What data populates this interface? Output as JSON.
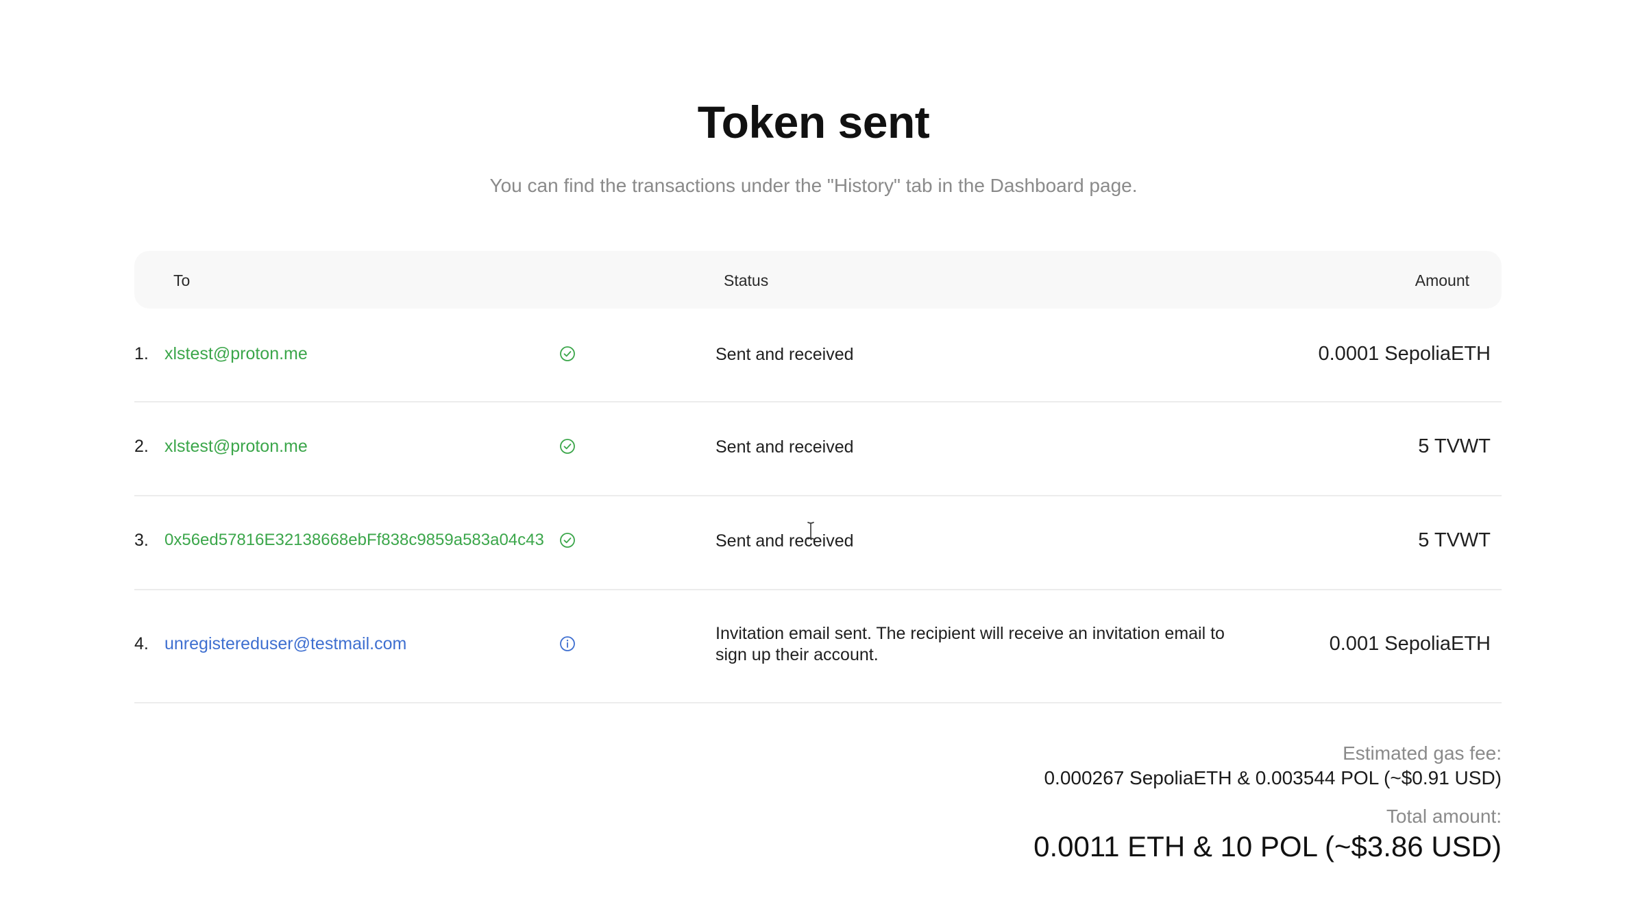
{
  "page": {
    "title": "Token sent",
    "subtitle": "You can find the transactions under the \"History\" tab in the Dashboard page."
  },
  "table": {
    "headers": {
      "to": "To",
      "status": "Status",
      "amount": "Amount"
    },
    "rows": [
      {
        "number": "1.",
        "recipient": "xlstest@proton.me",
        "recipient_color": "#3ba64a",
        "status_icon": "check-circle-icon",
        "status": "Sent and received",
        "amount": "0.0001 SepoliaETH"
      },
      {
        "number": "2.",
        "recipient": "xlstest@proton.me",
        "recipient_color": "#3ba64a",
        "status_icon": "check-circle-icon",
        "status": "Sent and received",
        "amount": "5 TVWT"
      },
      {
        "number": "3.",
        "recipient": "0x56ed57816E32138668ebFf838c9859a583a04c43",
        "recipient_color": "#3ba64a",
        "status_icon": "check-circle-icon",
        "status": "Sent and received",
        "amount": "5 TVWT"
      },
      {
        "number": "4.",
        "recipient": "unregistereduser@testmail.com",
        "recipient_color": "#3e6fd0",
        "status_icon": "info-circle-icon",
        "status": "Invitation email sent. The recipient will receive an invitation email to sign up their account.",
        "amount": "0.001 SepoliaETH"
      }
    ]
  },
  "summary": {
    "gas_fee_label": "Estimated gas fee:",
    "gas_fee_value": "0.000267 SepoliaETH & 0.003544 POL (~$0.91 USD)",
    "total_label": "Total amount:",
    "total_value": "0.0011 ETH & 10 POL (~$3.86 USD)"
  }
}
